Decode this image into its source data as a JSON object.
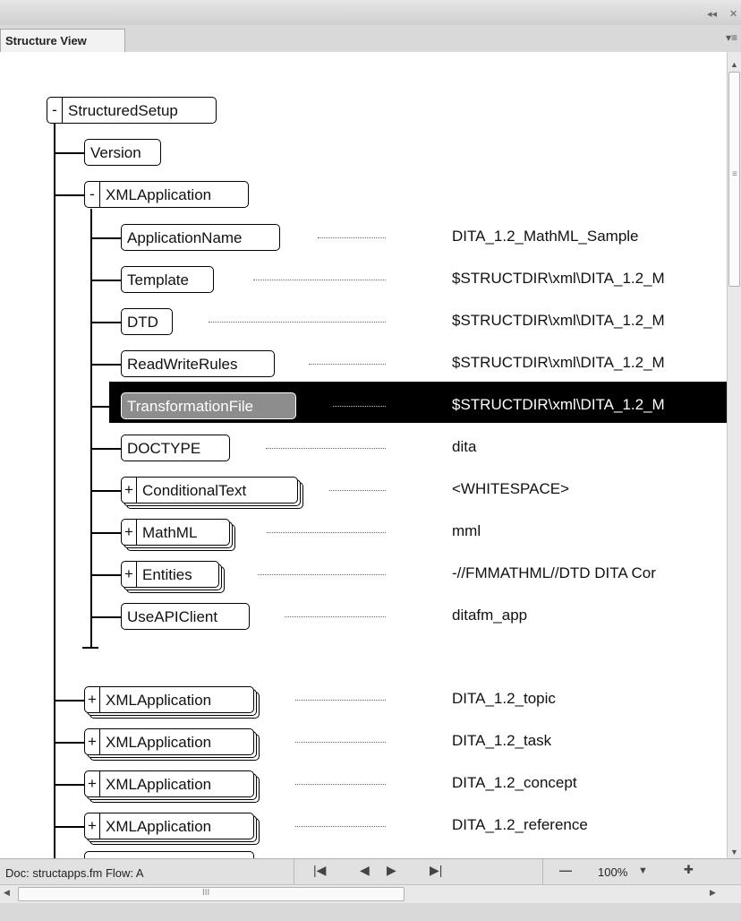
{
  "panel": {
    "tab_label": "Structure View",
    "collapse_glyph": "◂◂",
    "close_glyph": "✕",
    "menu_glyph": "▾≡"
  },
  "tree": {
    "root": {
      "toggle": "-",
      "label": "StructuredSetup"
    },
    "version": {
      "label": "Version"
    },
    "xmlapp": {
      "toggle": "-",
      "label": "XMLApplication"
    },
    "children": [
      {
        "label": "ApplicationName",
        "value": "DITA_1.2_MathML_Sample"
      },
      {
        "label": "Template",
        "value": "$STRUCTDIR\\xml\\DITA_1.2_M"
      },
      {
        "label": "DTD",
        "value": "$STRUCTDIR\\xml\\DITA_1.2_M"
      },
      {
        "label": "ReadWriteRules",
        "value": "$STRUCTDIR\\xml\\DITA_1.2_M"
      },
      {
        "label": "TransformationFile",
        "value": "$STRUCTDIR\\xml\\DITA_1.2_M"
      },
      {
        "label": "DOCTYPE",
        "value": "dita"
      },
      {
        "toggle": "+",
        "label": "ConditionalText",
        "value": "<WHITESPACE>"
      },
      {
        "toggle": "+",
        "label": "MathML",
        "value": "mml"
      },
      {
        "toggle": "+",
        "label": "Entities",
        "value": "-//FMMATHML//DTD DITA Cor"
      },
      {
        "label": "UseAPIClient",
        "value": "ditafm_app"
      }
    ],
    "siblings": [
      {
        "toggle": "+",
        "label": "XMLApplication",
        "value": "DITA_1.2_topic"
      },
      {
        "toggle": "+",
        "label": "XMLApplication",
        "value": "DITA_1.2_task"
      },
      {
        "toggle": "+",
        "label": "XMLApplication",
        "value": "DITA_1.2_concept"
      },
      {
        "toggle": "+",
        "label": "XMLApplication",
        "value": "DITA_1.2_reference"
      }
    ]
  },
  "status": {
    "doc": "Doc: structapps.fm Flow: A",
    "first": "|◀",
    "prev": "◀",
    "next": "▶",
    "last": "▶|",
    "zoom_out": "—",
    "zoom": "100%",
    "zoom_menu": "▼",
    "zoom_in": "✚"
  },
  "scroll": {
    "up": "▲",
    "down": "▼",
    "left": "◀",
    "right": "▶",
    "grip": "≡",
    "hgrip": "III"
  }
}
